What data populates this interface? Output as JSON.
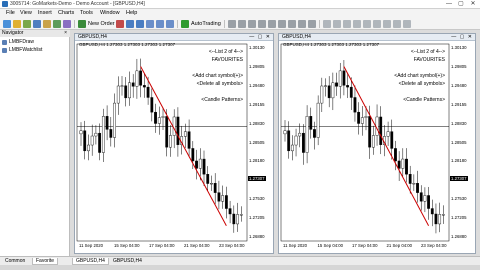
{
  "window": {
    "title": "3005714: GoMarkets-Demo - Demo Account - [GBPUSD,H4]",
    "minimize": "—",
    "maximize": "▢",
    "close": "✕"
  },
  "menu": [
    "File",
    "View",
    "Insert",
    "Charts",
    "Tools",
    "Window",
    "Help"
  ],
  "toolbar": {
    "new_order": "New Order",
    "autotrading": "AutoTrading"
  },
  "navigator": {
    "title": "Navigator",
    "close": "×",
    "items": [
      "LMBFDraw",
      "LMBFWatchlist"
    ],
    "tabs": [
      "Common",
      "Favorite"
    ]
  },
  "charts": [
    {
      "title": "GBPUSD,H4",
      "ohlc": "GBPUSD,H4  1.27303 1.27303 1.27303 1.27307",
      "panel": [
        "<--List 2 of 4-->",
        "FAVOURITES",
        "",
        "<Add chart symbol(+)>",
        "<Delete all symbols>",
        "",
        "<Candle Patterns>"
      ],
      "prices": [
        "1.30130",
        "1.29805",
        "1.29480",
        "1.29155",
        "1.28830",
        "1.28505",
        "1.28180",
        "1.27855",
        "1.27530",
        "1.27205",
        "1.26880"
      ],
      "current_price": "1.27307",
      "dates": [
        "11 Sep 2020",
        "15 Sep 04:00",
        "17 Sep 04:00",
        "21 Sep 04:00",
        "23 Sep 04:00"
      ]
    },
    {
      "title": "GBPUSD,H4",
      "ohlc": "GBPUSD,H4  1.27303 1.27303 1.27303 1.27307",
      "panel": [
        "<--List 2 of 4-->",
        "FAVOURITES",
        "",
        "<Add chart symbol(+)>",
        "<Delete all symbols>",
        "",
        "<Candle Patterns>"
      ],
      "prices": [
        "1.30130",
        "1.29805",
        "1.29480",
        "1.29155",
        "1.28830",
        "1.28505",
        "1.28180",
        "1.27855",
        "1.27530",
        "1.27205",
        "1.26880"
      ],
      "current_price": "1.27307",
      "dates": [
        "11 Sep 2020",
        "15 Sep 04:00",
        "17 Sep 04:00",
        "21 Sep 04:00",
        "23 Sep 04:00"
      ]
    }
  ],
  "chart_tabs": [
    "GBPUSD,H4",
    "GBPUSD,H4"
  ]
}
